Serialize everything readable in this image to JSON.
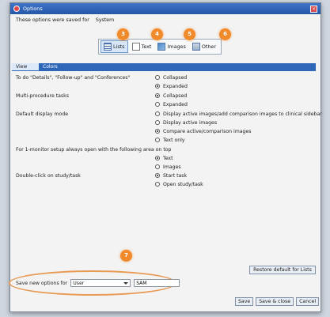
{
  "window": {
    "title": "Options"
  },
  "saved_for": {
    "label": "These options were saved for",
    "value": "System"
  },
  "categories": [
    {
      "label": "Lists",
      "badge": "3",
      "active": true
    },
    {
      "label": "Text",
      "badge": "4",
      "active": false
    },
    {
      "label": "Images",
      "badge": "5",
      "active": false
    },
    {
      "label": "Other",
      "badge": "6",
      "active": false
    }
  ],
  "tabs": [
    {
      "label": "View",
      "active": true
    },
    {
      "label": "Colors",
      "active": false
    }
  ],
  "groups": {
    "todo": {
      "label": "To do \"Details\", \"Follow-up\" and \"Conferences\"",
      "options": [
        {
          "label": "Collapsed",
          "selected": false
        },
        {
          "label": "Expanded",
          "selected": true
        }
      ]
    },
    "multi": {
      "label": "Multi-procedure tasks",
      "options": [
        {
          "label": "Collapsed",
          "selected": true
        },
        {
          "label": "Expanded",
          "selected": false
        }
      ]
    },
    "display": {
      "label": "Default display mode",
      "options": [
        {
          "label": "Display active images/add comparison images to clinical sidebar",
          "selected": false
        },
        {
          "label": "Display active images",
          "selected": false
        },
        {
          "label": "Compare active/comparison images",
          "selected": true
        },
        {
          "label": "Text only",
          "selected": false
        }
      ]
    },
    "monitor": {
      "label": "For 1-monitor setup always open with the following area on top",
      "options": [
        {
          "label": "Text",
          "selected": true
        },
        {
          "label": "Images",
          "selected": false
        }
      ]
    },
    "dblclick": {
      "label": "Double-click on study/task",
      "options": [
        {
          "label": "Start task",
          "selected": true
        },
        {
          "label": "Open study/task",
          "selected": false
        }
      ]
    }
  },
  "restore_label": "Restore default for Lists",
  "save_badge": "7",
  "save_new": {
    "label": "Save new options for",
    "select_value": "User",
    "input_value": "SAM"
  },
  "buttons": {
    "save": "Save",
    "save_close": "Save & close",
    "cancel": "Cancel"
  },
  "colors": {
    "tab_bar": "#2f67b8",
    "badge": "#f08a2b",
    "title_bar": "#2557a8"
  }
}
